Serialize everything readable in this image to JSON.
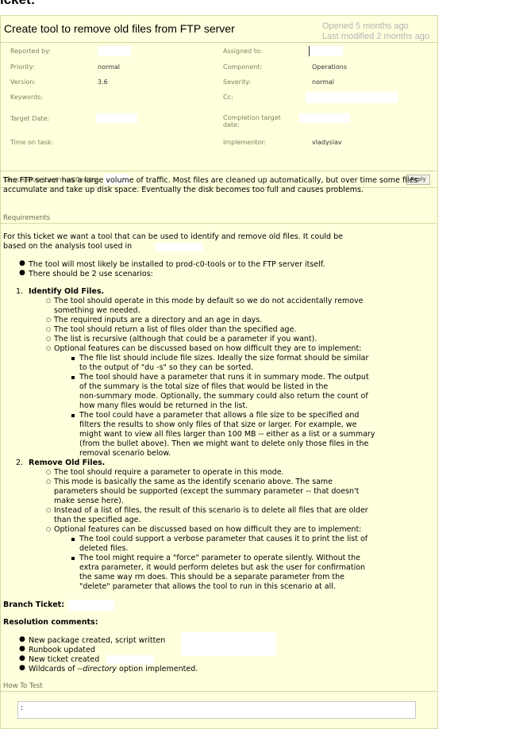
{
  "heading": "icket:",
  "ticket": {
    "title": "Create tool to remove old files from FTP server",
    "opened": "Opened 5 months ago",
    "modified": "Last modified 2 months ago"
  },
  "props": {
    "reported_by_label": "Reported by:",
    "assigned_to_label": "Assigned to:",
    "priority_label": "Priority:",
    "priority_value": "normal",
    "component_label": "Component:",
    "component_value": "Operations",
    "version_label": "Version:",
    "version_value": "3.6",
    "severity_label": "Severity:",
    "severity_value": "normal",
    "keywords_label": "Keywords:",
    "cc_label": "Cc:",
    "target_date_label": "Target Date:",
    "completion_label": "Completion target date:",
    "time_label": "Time on task:",
    "implementor_label": "Implementor:",
    "implementor_value": "vladyslav"
  },
  "description": {
    "label": "Description (Last modified by",
    "reply": "Reply",
    "intro": "The FTP server has a large volume of traffic. Most files are cleaned up automatically, but over time some files accumulate and take up disk space. Eventually the disk becomes too full and causes problems.",
    "requirements_head": "Requirements",
    "req_intro_1": "For this ticket we want a tool that can be used to identify and remove old files. It could be",
    "req_intro_2": "based on the analysis tool used in",
    "bullets": [
      "The tool will most likely be installed to prod-c0-tools or to the FTP server itself.",
      "There should be 2 use scenarios:"
    ],
    "s1_num": "1.",
    "s1_title": "Identify Old Files.",
    "s1_lines": [
      "The tool should operate in this mode by default so we do not accidentally remove",
      "something we needed.",
      "The required inputs are a directory and an age in days.",
      "The tool should return a list of files older than the specified age.",
      "The list is recursive (although that could be a parameter if you want).",
      "Optional features can be discussed based on how difficult they are to implement:"
    ],
    "s1_sub": [
      "The file list should include file sizes. Ideally the size format should be similar",
      "to the output of \"du -s\" so they can be sorted.",
      "The tool should have a parameter that runs it in summary mode. The output",
      "of the summary is the total size of files that would be listed in the",
      "non-summary mode. Optionally, the summary could also return the count of",
      "how many files would be returned in the list.",
      "The tool could have a parameter that allows a file size to be specified and",
      "filters the results to show only files of that size or larger. For example, we",
      "might want to view all files larger than 100 MB -- either as a list or a summary",
      "(from the bullet above). Then we might want to delete only those files in the",
      "removal scenario below."
    ],
    "s2_num": "2.",
    "s2_title": "Remove Old Files.",
    "s2_lines": [
      "The tool should require a parameter to operate in this mode.",
      "This mode is basically the same as the identify scenario above. The same",
      "parameters should be supported (except the summary parameter -- that doesn't",
      "make sense here).",
      "Instead of a list of files, the result of this scenario is to delete all files that are older",
      "than the specified age.",
      "Optional features can be discussed based on how difficult they are to implement:"
    ],
    "s2_sub": [
      "The tool could support a verbose parameter that causes it to print the list of",
      "deleted files.",
      "The tool might require a \"force\" parameter to operate silently. Without the",
      "extra parameter, it would perform deletes but ask the user for confirmation",
      "the same way rm does. This should be a separate parameter from the",
      "\"delete\" parameter that allows the tool to run in this scenario at all."
    ],
    "branch": "Branch Ticket:",
    "resolution": "Resolution comments:",
    "res_items": [
      "New package created, script written",
      "Runbook updated",
      "New ticket created"
    ],
    "wild_pre": "Wildcards of --",
    "wild_em": "directory",
    "wild_post": " option implemented.",
    "howto": "How To Test",
    "textarea_text": ":"
  }
}
